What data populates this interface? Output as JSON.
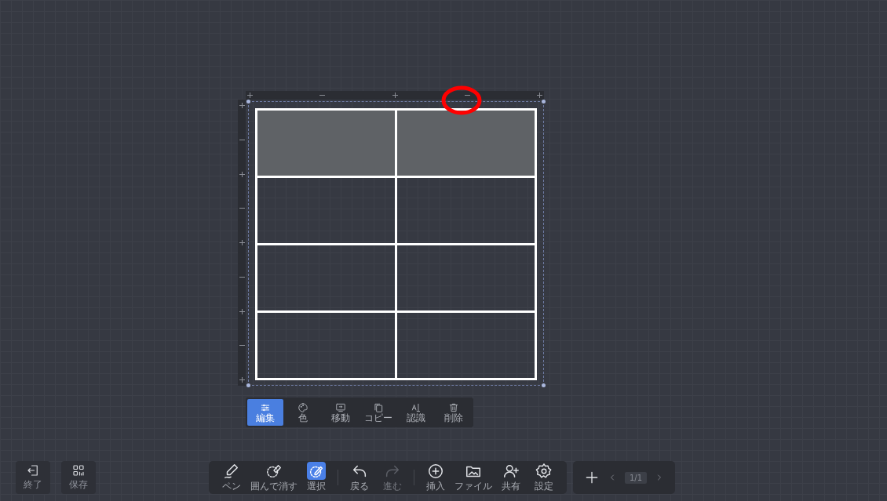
{
  "table": {
    "rows": [
      {
        "cells": [
          {
            "shaded": true
          },
          {
            "shaded": true
          }
        ]
      },
      {
        "cells": [
          {
            "shaded": false
          },
          {
            "shaded": false
          }
        ]
      },
      {
        "cells": [
          {
            "shaded": false
          },
          {
            "shaded": false
          }
        ]
      },
      {
        "cells": [
          {
            "shaded": false
          },
          {
            "shaded": false
          }
        ]
      }
    ]
  },
  "context_menu": [
    {
      "kind": "edit",
      "label": "編集",
      "selected": true
    },
    {
      "kind": "color",
      "label": "色",
      "selected": false
    },
    {
      "kind": "move",
      "label": "移動",
      "selected": false
    },
    {
      "kind": "copy",
      "label": "コピー",
      "selected": false
    },
    {
      "kind": "recognize",
      "label": "認識",
      "selected": false
    },
    {
      "kind": "delete",
      "label": "削除",
      "selected": false
    }
  ],
  "left_buttons": [
    {
      "kind": "exit",
      "label": "終了"
    },
    {
      "kind": "save",
      "label": "保存"
    }
  ],
  "toolbar": [
    [
      {
        "kind": "pen",
        "label": "ペン",
        "selected": false,
        "disabled": false
      },
      {
        "kind": "lasso",
        "label": "囲んで消す",
        "selected": false,
        "disabled": false
      },
      {
        "kind": "select",
        "label": "選択",
        "selected": true,
        "disabled": false
      }
    ],
    [
      {
        "kind": "undo",
        "label": "戻る",
        "selected": false,
        "disabled": false
      },
      {
        "kind": "redo",
        "label": "進む",
        "selected": false,
        "disabled": true
      }
    ],
    [
      {
        "kind": "insert",
        "label": "挿入",
        "selected": false,
        "disabled": false
      },
      {
        "kind": "file",
        "label": "ファイル",
        "selected": false,
        "disabled": false
      },
      {
        "kind": "share",
        "label": "共有",
        "selected": false,
        "disabled": false
      },
      {
        "kind": "settings",
        "label": "設定",
        "selected": false,
        "disabled": false
      }
    ]
  ],
  "pager": {
    "page": "1/1"
  }
}
